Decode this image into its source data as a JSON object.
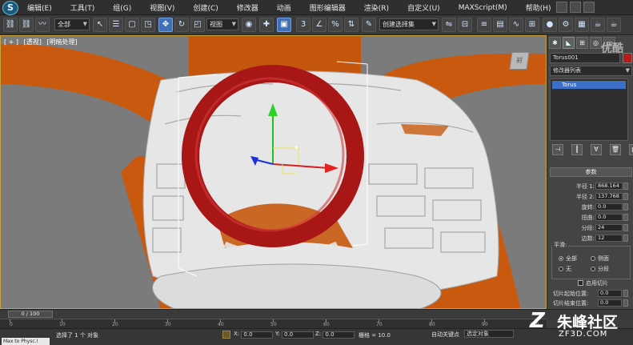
{
  "app": {
    "logo": "S"
  },
  "menu": [
    "编辑(E)",
    "工具(T)",
    "组(G)",
    "视图(V)",
    "创建(C)",
    "修改器",
    "动画",
    "图形编辑器",
    "渲染(R)",
    "自定义(U)",
    "MAXScript(M)",
    "帮助(H)"
  ],
  "toolbar": {
    "selection_filter": "全部",
    "ref_coord": "视图",
    "named_selection": "创建选择集"
  },
  "viewport": {
    "labels": [
      "[ + ]",
      "[透视]",
      "[明暗处理]"
    ],
    "viewcube_label": "前"
  },
  "command_panel": {
    "object_name": "Torus001",
    "object_color": "#b51d1d",
    "modifier_list": "修改器列表",
    "stack_items": [
      "Torus"
    ],
    "rollout_title": "参数",
    "params": [
      {
        "label": "半径 1:",
        "value": "868.164"
      },
      {
        "label": "半径 2:",
        "value": "137.768"
      },
      {
        "label": "旋转:",
        "value": "0.0"
      },
      {
        "label": "扭曲:",
        "value": "0.0"
      },
      {
        "label": "分段:",
        "value": "24"
      },
      {
        "label": "边数:",
        "value": "12"
      }
    ],
    "smooth_title": "平滑:",
    "smooth_options": [
      {
        "label": "全部",
        "selected": true
      },
      {
        "label": "侧面",
        "selected": false
      },
      {
        "label": "无",
        "selected": false
      },
      {
        "label": "分段",
        "selected": false
      }
    ],
    "slice_on_label": "启用切片",
    "slice_from_label": "切片起始位置:",
    "slice_from_value": "0.0",
    "slice_to_label": "切片结束位置:",
    "slice_to_value": "0.0"
  },
  "timeline": {
    "frame": "0 / 100",
    "ticks": [
      "0",
      "10",
      "20",
      "30",
      "40",
      "50",
      "60",
      "70",
      "80",
      "90",
      "100"
    ]
  },
  "status": {
    "maxscript": "Max to Physc.!",
    "message": "选择了 1 个 对象",
    "x_label": "X:",
    "x_value": "0.0",
    "y_label": "Y:",
    "y_value": "0.0",
    "z_label": "Z:",
    "z_value": "0.0",
    "grid": "栅格 = 10.0",
    "autokey": "自动关键点",
    "selection": "选定对象"
  },
  "watermarks": {
    "top": "优酷",
    "brand": "朱峰社区",
    "url": "ZF3D.COM"
  },
  "colors": {
    "orange": "#c8590f",
    "red": "#a81616",
    "accent": "#3f6fb7"
  }
}
